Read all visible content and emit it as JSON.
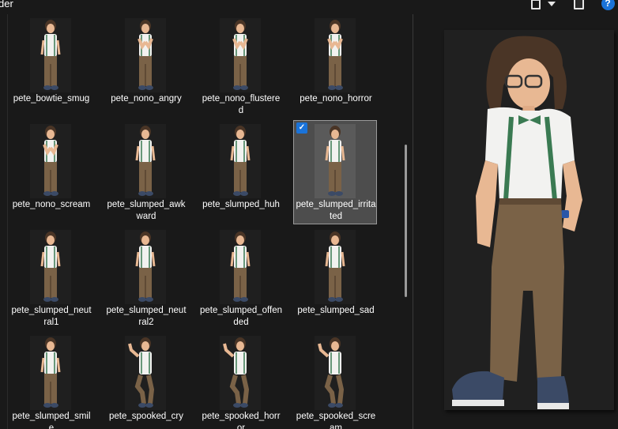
{
  "window": {
    "title": "der"
  },
  "toolbar": {
    "view_icon": "view-icon",
    "view_dropdown_icon": "chevron-down-icon",
    "preview_pane_icon": "preview-pane-icon",
    "help_label": "?"
  },
  "files": [
    {
      "name": "pete_bowtie_smug",
      "pose": "smug",
      "selected": false
    },
    {
      "name": "pete_nono_angry",
      "pose": "nono",
      "selected": false
    },
    {
      "name": "pete_nono_flustered",
      "pose": "nono",
      "selected": false
    },
    {
      "name": "pete_nono_horror",
      "pose": "nono",
      "selected": false
    },
    {
      "name": "pete_nono_scream",
      "pose": "nono",
      "selected": false
    },
    {
      "name": "pete_slumped_awkward",
      "pose": "slumped",
      "selected": false
    },
    {
      "name": "pete_slumped_huh",
      "pose": "slumped",
      "selected": false
    },
    {
      "name": "pete_slumped_irritated",
      "pose": "slumped",
      "selected": true
    },
    {
      "name": "pete_slumped_neutral1",
      "pose": "slumped",
      "selected": false
    },
    {
      "name": "pete_slumped_neutral2",
      "pose": "slumped",
      "selected": false
    },
    {
      "name": "pete_slumped_offended",
      "pose": "slumped",
      "selected": false
    },
    {
      "name": "pete_slumped_sad",
      "pose": "slumped",
      "selected": false
    },
    {
      "name": "pete_slumped_smile",
      "pose": "slumped",
      "selected": false
    },
    {
      "name": "pete_spooked_cry",
      "pose": "spooked",
      "selected": false
    },
    {
      "name": "pete_spooked_horror",
      "pose": "spooked",
      "selected": false
    },
    {
      "name": "pete_spooked_scream",
      "pose": "spooked",
      "selected": false
    }
  ],
  "colors": {
    "background": "#191919",
    "selection": "#4d4d4d",
    "accent": "#1a73d9",
    "shirt": "#f2f2f0",
    "pants": "#7a6247",
    "hair": "#4a3526",
    "skin": "#e8b893",
    "tie": "#3a7a52",
    "shoes": "#3b4a66"
  }
}
